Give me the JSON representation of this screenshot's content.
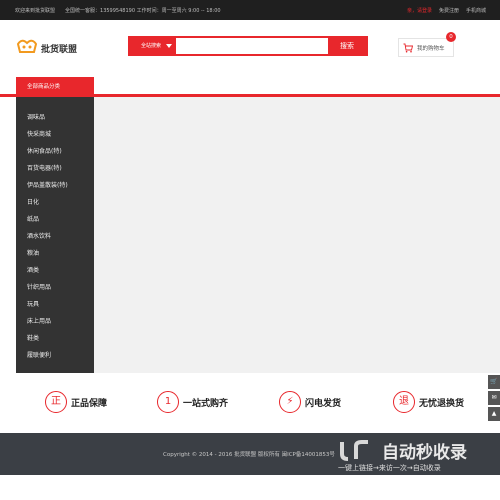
{
  "topbar": {
    "welcome": "欢迎来到批货联盟",
    "hotline": "全国统一客服：13599548190 工作时间：周一至周六 9:00 -- 18:00",
    "login": "亲，请登录",
    "register": "免费注册",
    "mobile": "手机商城"
  },
  "logo": {
    "text": "批货联盟"
  },
  "search": {
    "scope": "全站搜索",
    "placeholder": "",
    "button": "搜索"
  },
  "cart": {
    "label": "我的购物车",
    "count": "0"
  },
  "categories": {
    "title": "全部商品分类",
    "items": [
      "调味品",
      "快采商城",
      "休闲食品(特)",
      "百货电器(特)",
      "伊品盖散装(特)",
      "日化",
      "纸品",
      "酒水饮料",
      "粮油",
      "酒类",
      "针织用品",
      "玩具",
      "床上用品",
      "鞋类",
      "履联便利"
    ]
  },
  "features": [
    {
      "icon": "正",
      "label": "正品保障",
      "icon_name": "genuine-icon"
    },
    {
      "icon": "1",
      "label": "一站式购齐",
      "icon_name": "one-stop-icon"
    },
    {
      "icon": "⚡",
      "label": "闪电发货",
      "icon_name": "lightning-icon"
    },
    {
      "icon": "退",
      "label": "无忧退换货",
      "icon_name": "return-icon"
    }
  ],
  "footer": {
    "copyright": "Copyright © 2014 - 2016  批货联盟  版权所有  闽ICP备14001853号"
  },
  "watermark": {
    "title": "自动秒收录",
    "subtitle": "一键上链接→来访一次→自动收录"
  },
  "colors": {
    "accent": "#e8272c",
    "topbar": "#1f1f1f",
    "menu": "#333333",
    "footer": "#3b3f45"
  }
}
